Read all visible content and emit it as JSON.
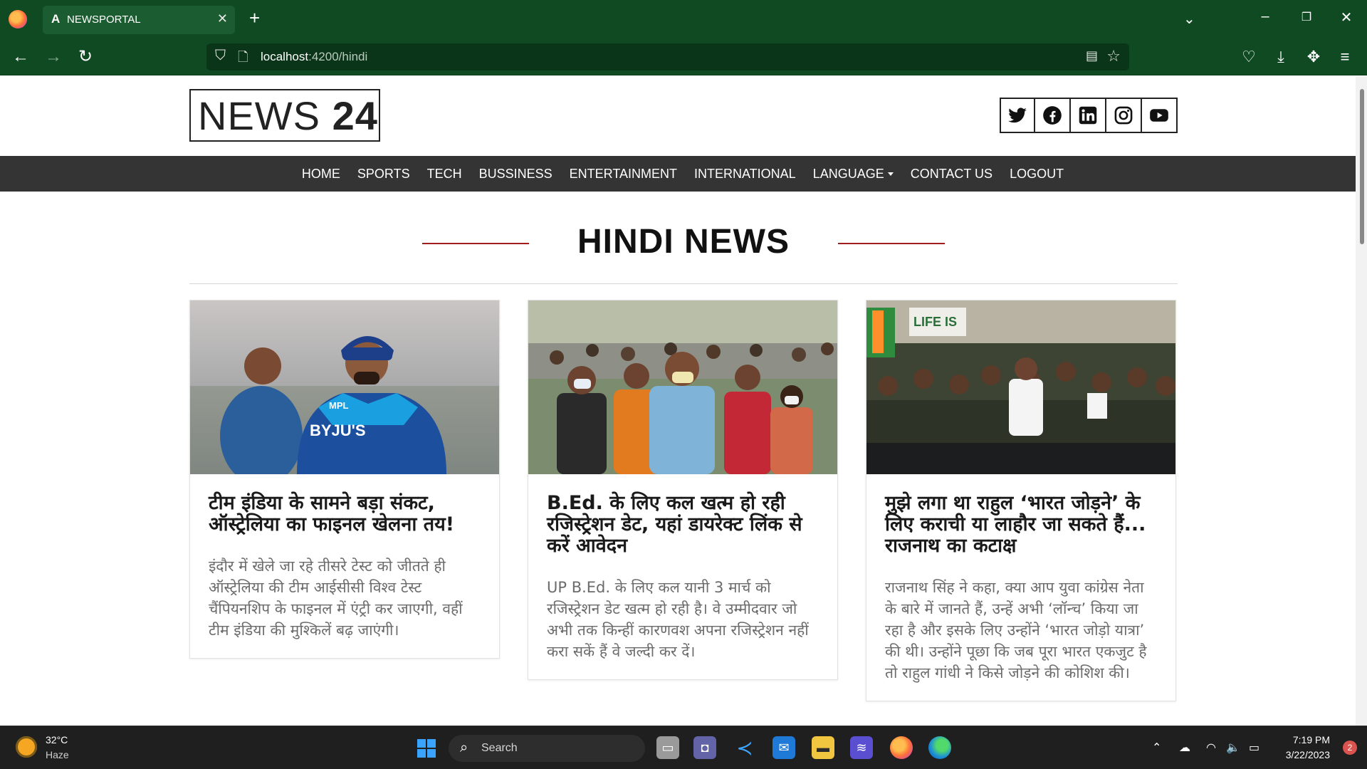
{
  "browser": {
    "tab_title": "NEWSPORTAL",
    "tab_icon": "A",
    "url_host": "localhost",
    "url_path": ":4200/hindi"
  },
  "site": {
    "logo_word": "NEWS",
    "logo_num": "24",
    "nav": [
      "HOME",
      "SPORTS",
      "TECH",
      "BUSSINESS",
      "ENTERTAINMENT",
      "INTERNATIONAL",
      "LANGUAGE",
      "CONTACT US",
      "LOGOUT"
    ],
    "socials": [
      "twitter-icon",
      "facebook-icon",
      "linkedin-icon",
      "instagram-icon",
      "youtube-icon"
    ]
  },
  "section": {
    "title": "HINDI NEWS"
  },
  "cards": [
    {
      "title": "टीम इंडिया के सामने बड़ा संकट, ऑस्ट्रेलिया का फाइनल खेलना तय!",
      "text": "इंदौर में खेले जा रहे तीसरे टेस्ट को जीतते ही ऑस्ट्रेलिया की टीम आईसीसी विश्व टेस्ट चैंपियनशिप के फाइनल में एंट्री कर जाएगी, वहीं टीम इंडिया की मुश्किलें बढ़ जाएंगी।"
    },
    {
      "title": "B.Ed. के लिए कल खत्म हो रही रजिस्ट्रेशन डेट, यहां डायरेक्ट लिंक से करें आवेदन",
      "text": "UP B.Ed. के लिए कल यानी 3 मार्च को रजिस्ट्रेशन डेट खत्म हो रही है। वे उम्मीदवार जो अभी तक किन्हीं कारणवश अपना रजिस्ट्रेशन नहीं करा सकें हैं वे जल्दी कर दें।"
    },
    {
      "title": "मुझे लगा था राहुल ‘भारत जोड़ने’ के लिए कराची या लाहौर जा सकते हैं... राजनाथ का कटाक्ष",
      "text": "राजनाथ सिंह ने कहा, क्या आप युवा कांग्रेस नेता के बारे में जानते हैं, उन्हें अभी ‘लॉन्च’ किया जा रहा है और इसके लिए उन्होंने ‘भारत जोड़ो यात्रा’ की थी। उन्होंने पूछा कि जब पूरा भारत एकजुट है तो राहुल गांधी ने किसे जोड़ने की कोशिश की।"
    }
  ],
  "taskbar": {
    "temp": "32°C",
    "weather": "Haze",
    "search": "Search",
    "time": "7:19 PM",
    "date": "3/22/2023",
    "notifications": "2"
  },
  "colors": {
    "browser_green": "#0f4a22",
    "nav_dark": "#343434",
    "accent_red": "#a11c1c"
  }
}
